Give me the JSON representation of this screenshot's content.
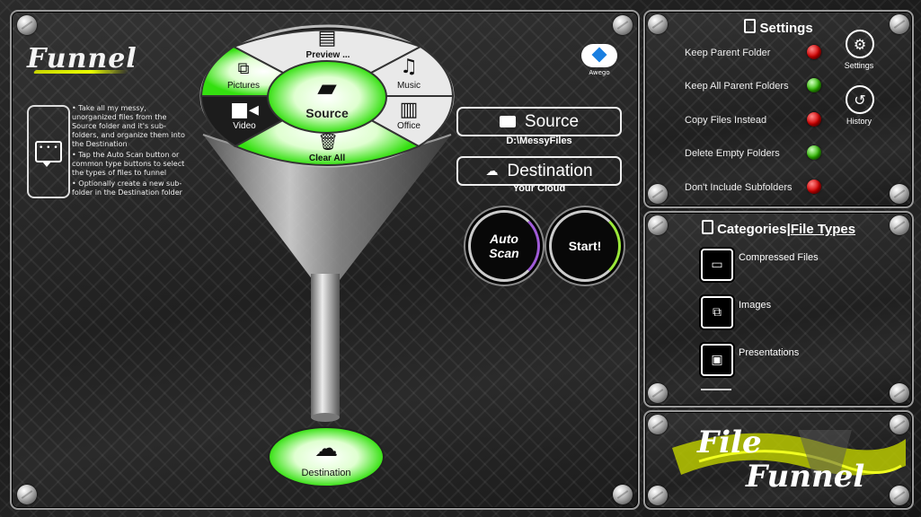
{
  "app": {
    "logo_text": "Funnel",
    "help_lines": [
      "Take all my messy, unorganized files from the Source folder and it's sub-folders, and organize them into the Destination",
      "Tap the Auto Scan button or common type buttons to select the types of files to funnel",
      "Optionally create a new sub-folder in the Destination folder"
    ]
  },
  "funnel": {
    "segments": {
      "preview": "Preview ...",
      "pictures": "Pictures",
      "music": "Music",
      "video": "Video",
      "office": "Office",
      "clear_all": "Clear All",
      "source": "Source"
    },
    "destination_label": "Destination"
  },
  "cloud_provider": {
    "name": "Awego"
  },
  "source": {
    "label": "Source",
    "path": "D:\\MessyFiles"
  },
  "destination": {
    "label": "Destination",
    "path": "Your Cloud"
  },
  "actions": {
    "auto_scan_line1": "Auto",
    "auto_scan_line2": "Scan",
    "start": "Start!"
  },
  "settings": {
    "title": "Settings",
    "items": [
      {
        "label": "Keep Parent Folder",
        "state": "red"
      },
      {
        "label": "Keep All Parent Folders",
        "state": "green"
      },
      {
        "label": "Copy Files Instead",
        "state": "red"
      },
      {
        "label": "Delete Empty Folders",
        "state": "green"
      },
      {
        "label": "Don't Include Subfolders",
        "state": "red"
      }
    ],
    "settings_button": "Settings",
    "history_button": "History"
  },
  "categories": {
    "title_part1": "Categories",
    "title_part2": "File Types",
    "items": [
      {
        "label": "Compressed Files"
      },
      {
        "label": "Images"
      },
      {
        "label": "Presentations"
      }
    ]
  },
  "brand": {
    "line1": "File",
    "line2": "Funnel"
  },
  "colors": {
    "accent_green": "#39ff14",
    "brand_yellow": "#e6ff00",
    "led_red": "#d10000",
    "led_green": "#2fb600"
  }
}
